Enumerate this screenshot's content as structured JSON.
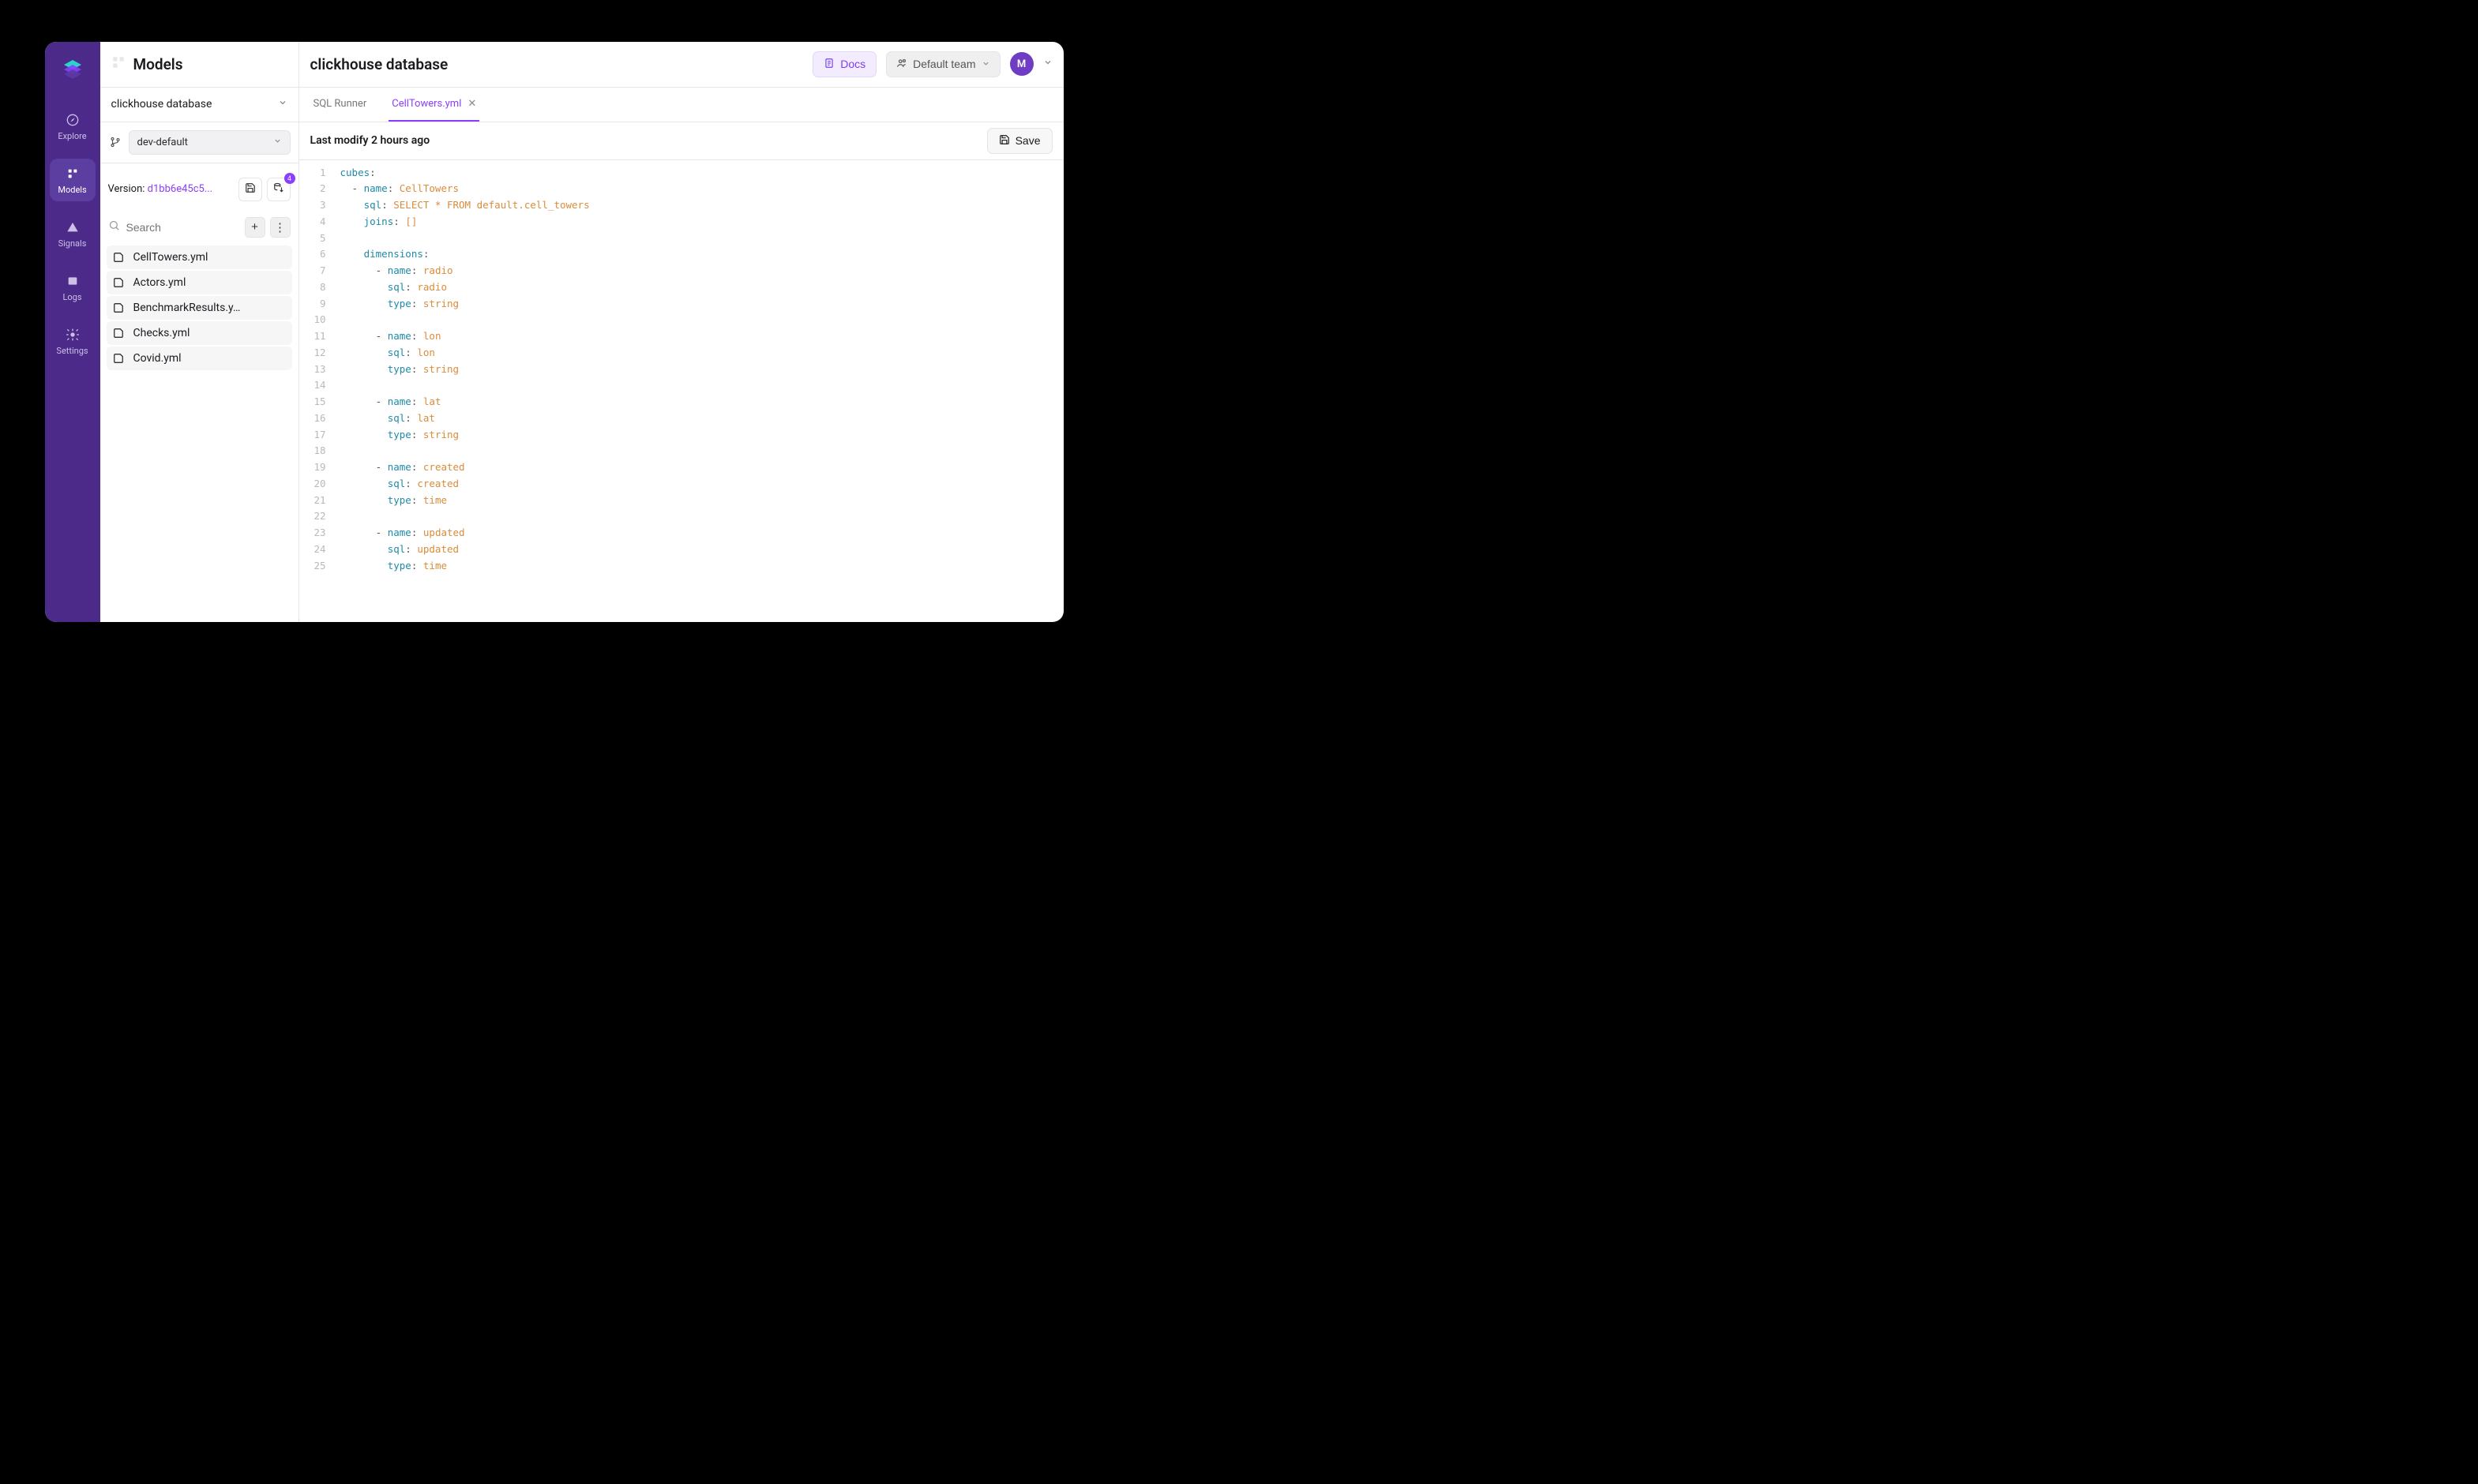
{
  "nav": {
    "items": [
      {
        "label": "Explore"
      },
      {
        "label": "Models"
      },
      {
        "label": "Signals"
      },
      {
        "label": "Logs"
      },
      {
        "label": "Settings"
      }
    ]
  },
  "sidebar": {
    "title": "Models",
    "database_name": "clickhouse database",
    "branch": "dev-default",
    "version_label": "Version:",
    "version_hash": "d1bb6e45c5...",
    "sync_badge": "4",
    "search_placeholder": "Search",
    "files": [
      {
        "name": "CellTowers.yml"
      },
      {
        "name": "Actors.yml"
      },
      {
        "name": "BenchmarkResults.y…"
      },
      {
        "name": "Checks.yml"
      },
      {
        "name": "Covid.yml"
      }
    ]
  },
  "header": {
    "title": "clickhouse database",
    "docs_label": "Docs",
    "team_label": "Default team",
    "avatar_initial": "M"
  },
  "tabs": {
    "sql_runner": "SQL Runner",
    "active_file": "CellTowers.yml"
  },
  "toolbar": {
    "status": "Last modify 2 hours ago",
    "save_label": "Save"
  },
  "editor": {
    "lines": [
      {
        "n": 1,
        "segs": [
          [
            "k",
            "cubes"
          ],
          [
            "p",
            ":"
          ]
        ]
      },
      {
        "n": 2,
        "segs": [
          [
            "p",
            "  - "
          ],
          [
            "k",
            "name"
          ],
          [
            "p",
            ": "
          ],
          [
            "v",
            "CellTowers"
          ]
        ]
      },
      {
        "n": 3,
        "segs": [
          [
            "p",
            "    "
          ],
          [
            "k",
            "sql"
          ],
          [
            "p",
            ": "
          ],
          [
            "v",
            "SELECT * FROM default.cell_towers"
          ]
        ]
      },
      {
        "n": 4,
        "segs": [
          [
            "p",
            "    "
          ],
          [
            "k",
            "joins"
          ],
          [
            "p",
            ": "
          ],
          [
            "v",
            "[]"
          ]
        ]
      },
      {
        "n": 5,
        "segs": []
      },
      {
        "n": 6,
        "segs": [
          [
            "p",
            "    "
          ],
          [
            "k",
            "dimensions"
          ],
          [
            "p",
            ":"
          ]
        ]
      },
      {
        "n": 7,
        "segs": [
          [
            "p",
            "      - "
          ],
          [
            "k",
            "name"
          ],
          [
            "p",
            ": "
          ],
          [
            "v",
            "radio"
          ]
        ]
      },
      {
        "n": 8,
        "segs": [
          [
            "p",
            "        "
          ],
          [
            "k",
            "sql"
          ],
          [
            "p",
            ": "
          ],
          [
            "v",
            "radio"
          ]
        ]
      },
      {
        "n": 9,
        "segs": [
          [
            "p",
            "        "
          ],
          [
            "k",
            "type"
          ],
          [
            "p",
            ": "
          ],
          [
            "v",
            "string"
          ]
        ]
      },
      {
        "n": 10,
        "segs": []
      },
      {
        "n": 11,
        "segs": [
          [
            "p",
            "      - "
          ],
          [
            "k",
            "name"
          ],
          [
            "p",
            ": "
          ],
          [
            "v",
            "lon"
          ]
        ]
      },
      {
        "n": 12,
        "segs": [
          [
            "p",
            "        "
          ],
          [
            "k",
            "sql"
          ],
          [
            "p",
            ": "
          ],
          [
            "v",
            "lon"
          ]
        ]
      },
      {
        "n": 13,
        "segs": [
          [
            "p",
            "        "
          ],
          [
            "k",
            "type"
          ],
          [
            "p",
            ": "
          ],
          [
            "v",
            "string"
          ]
        ]
      },
      {
        "n": 14,
        "segs": []
      },
      {
        "n": 15,
        "segs": [
          [
            "p",
            "      - "
          ],
          [
            "k",
            "name"
          ],
          [
            "p",
            ": "
          ],
          [
            "v",
            "lat"
          ]
        ]
      },
      {
        "n": 16,
        "segs": [
          [
            "p",
            "        "
          ],
          [
            "k",
            "sql"
          ],
          [
            "p",
            ": "
          ],
          [
            "v",
            "lat"
          ]
        ]
      },
      {
        "n": 17,
        "segs": [
          [
            "p",
            "        "
          ],
          [
            "k",
            "type"
          ],
          [
            "p",
            ": "
          ],
          [
            "v",
            "string"
          ]
        ]
      },
      {
        "n": 18,
        "segs": []
      },
      {
        "n": 19,
        "segs": [
          [
            "p",
            "      - "
          ],
          [
            "k",
            "name"
          ],
          [
            "p",
            ": "
          ],
          [
            "v",
            "created"
          ]
        ]
      },
      {
        "n": 20,
        "segs": [
          [
            "p",
            "        "
          ],
          [
            "k",
            "sql"
          ],
          [
            "p",
            ": "
          ],
          [
            "v",
            "created"
          ]
        ]
      },
      {
        "n": 21,
        "segs": [
          [
            "p",
            "        "
          ],
          [
            "k",
            "type"
          ],
          [
            "p",
            ": "
          ],
          [
            "v",
            "time"
          ]
        ]
      },
      {
        "n": 22,
        "segs": []
      },
      {
        "n": 23,
        "segs": [
          [
            "p",
            "      - "
          ],
          [
            "k",
            "name"
          ],
          [
            "p",
            ": "
          ],
          [
            "v",
            "updated"
          ]
        ]
      },
      {
        "n": 24,
        "segs": [
          [
            "p",
            "        "
          ],
          [
            "k",
            "sql"
          ],
          [
            "p",
            ": "
          ],
          [
            "v",
            "updated"
          ]
        ]
      },
      {
        "n": 25,
        "segs": [
          [
            "p",
            "        "
          ],
          [
            "k",
            "type"
          ],
          [
            "p",
            ": "
          ],
          [
            "v",
            "time"
          ]
        ]
      }
    ]
  }
}
